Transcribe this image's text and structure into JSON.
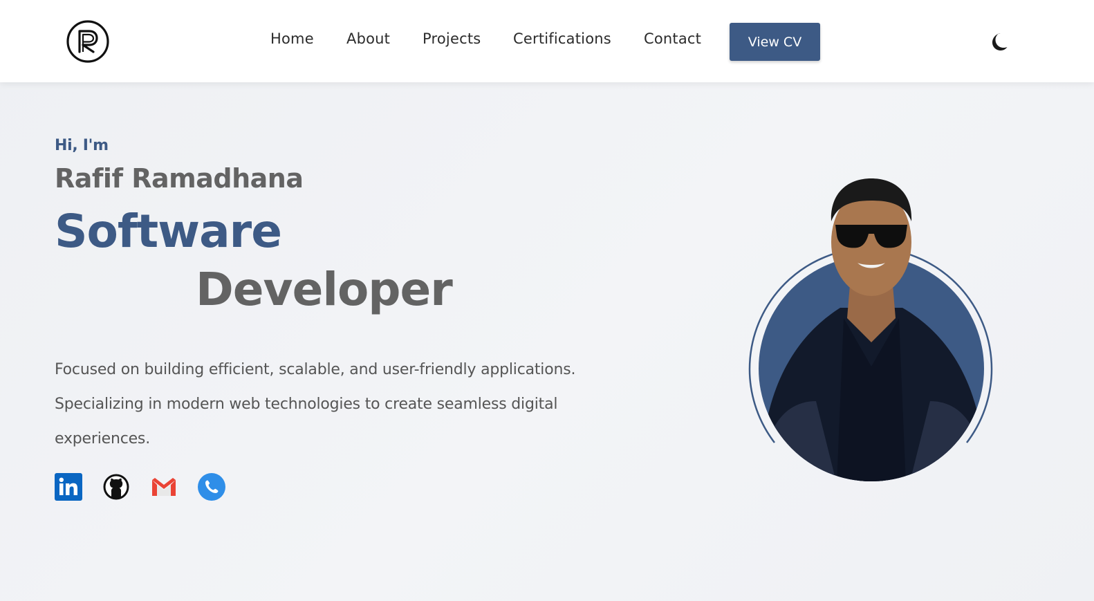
{
  "nav": {
    "logo_alt": "R",
    "links": [
      "Home",
      "About",
      "Projects",
      "Certifications",
      "Contact"
    ],
    "cv_button": "View CV",
    "theme_icon": "moon-icon"
  },
  "hero": {
    "greeting": "Hi, I'm",
    "name": "Rafif Ramadhana",
    "role_line_1": "Software",
    "role_line_2": "Developer",
    "description": "Focused on building efficient, scalable, and user-friendly applications. Specializing in modern web technologies to create seamless digital experiences."
  },
  "socials": [
    {
      "name": "linkedin-icon",
      "color": "#0a66c2"
    },
    {
      "name": "github-icon",
      "color": "#111111"
    },
    {
      "name": "gmail-icon",
      "color": "#ea4335"
    },
    {
      "name": "phone-icon",
      "color": "#2f8ee8"
    }
  ],
  "colors": {
    "accent": "#3d5a85",
    "heading_gray": "#636363",
    "text": "#555555"
  }
}
